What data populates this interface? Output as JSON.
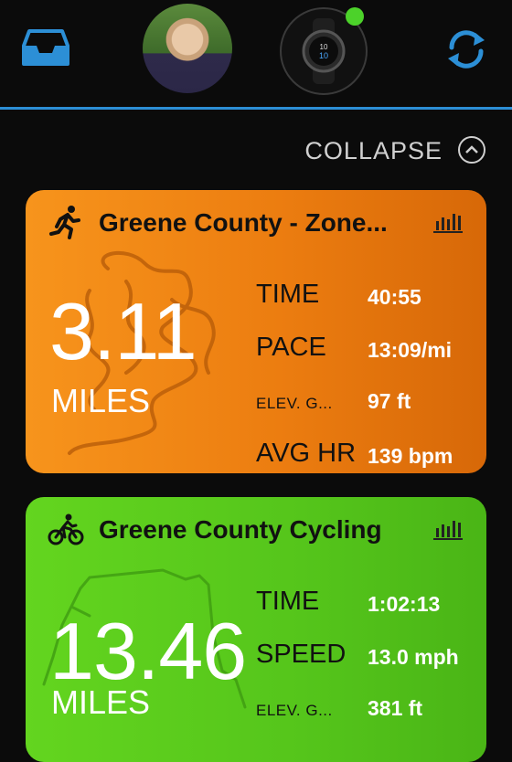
{
  "header": {
    "inbox_icon": "inbox-tray-icon",
    "profile_avatar": "profile-photo",
    "watch_icon": "watch-device-icon",
    "watch_status_color": "#4cd22a",
    "sync_icon": "sync-arrows-icon",
    "accent_color": "#2c8fd6"
  },
  "collapse": {
    "label": "COLLAPSE",
    "icon": "chevron-up-circle-icon"
  },
  "cards": [
    {
      "type": "running",
      "icon": "runner-icon",
      "title": "Greene County - Zone...",
      "color": "#f7941c",
      "big_value": "3.11",
      "big_unit": "MILES",
      "stats": [
        {
          "label": "TIME",
          "value": "40:55"
        },
        {
          "label": "PACE",
          "value": "13:09/mi"
        },
        {
          "label": "ELEV. G...",
          "value": "97 ft"
        },
        {
          "label": "AVG HR",
          "value": "139 bpm"
        }
      ]
    },
    {
      "type": "cycling",
      "icon": "cyclist-icon",
      "title": "Greene County Cycling",
      "color": "#63d51f",
      "big_value": "13.46",
      "big_unit": "MILES",
      "stats": [
        {
          "label": "TIME",
          "value": "1:02:13"
        },
        {
          "label": "SPEED",
          "value": "13.0 mph"
        },
        {
          "label": "ELEV. G...",
          "value": "381 ft"
        }
      ]
    }
  ]
}
